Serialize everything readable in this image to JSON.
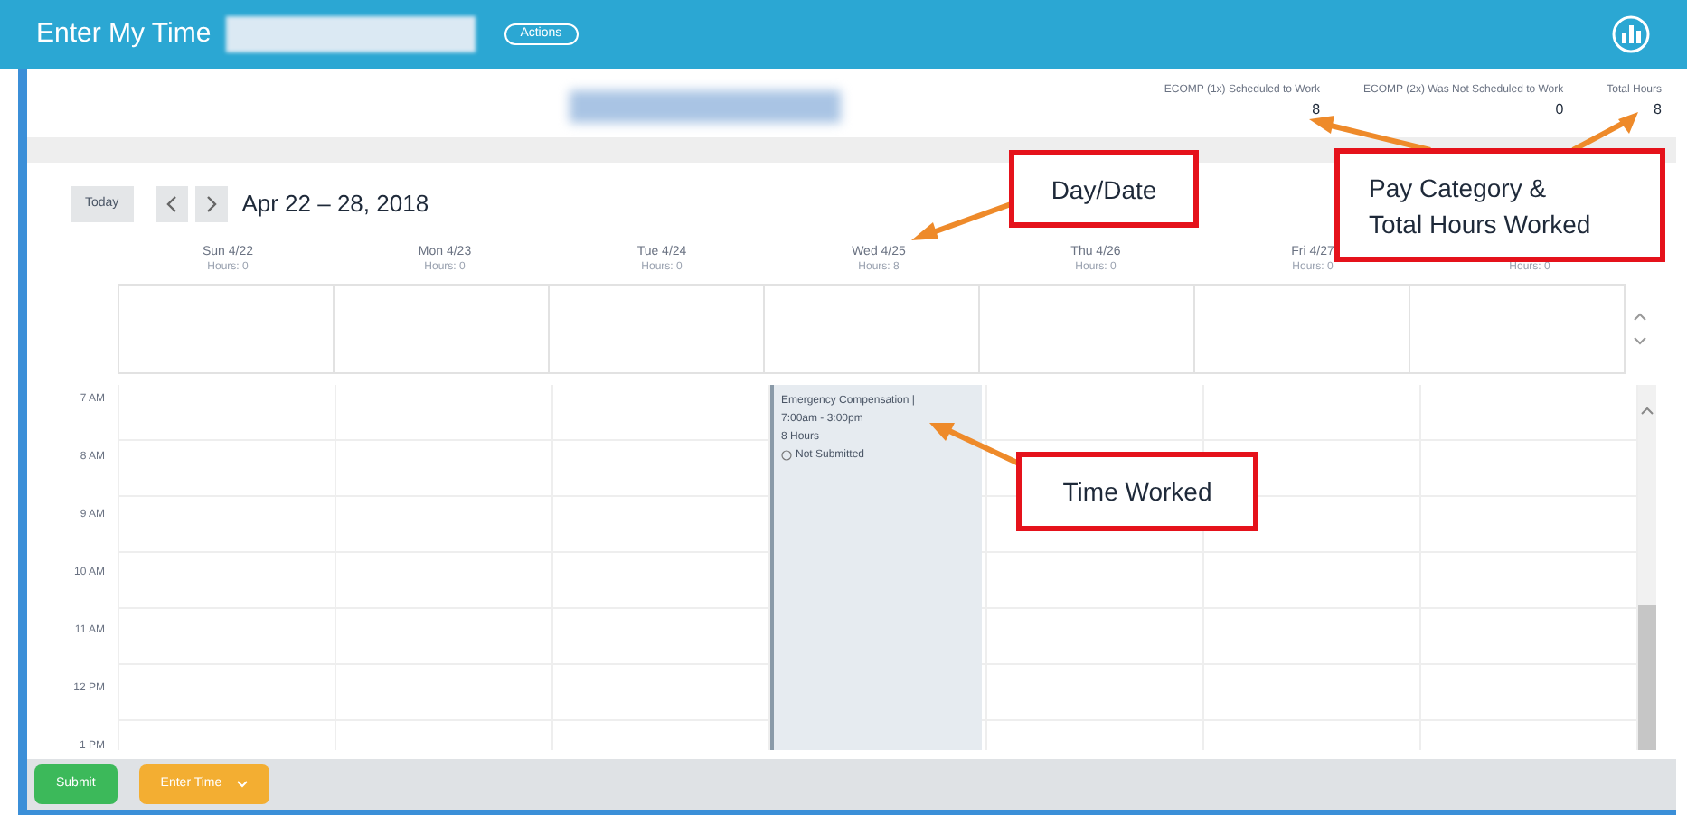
{
  "header": {
    "title": "Enter My Time",
    "actions_button": "Actions"
  },
  "summary": [
    {
      "label": "ECOMP (1x) Scheduled to Work",
      "value": "8"
    },
    {
      "label": "ECOMP (2x) Was Not Scheduled to Work",
      "value": "0"
    },
    {
      "label": "Total Hours",
      "value": "8"
    }
  ],
  "toolbar": {
    "today_button": "Today",
    "date_range": "Apr 22 – 28, 2018"
  },
  "days": [
    {
      "label": "Sun 4/22",
      "hours": "Hours: 0"
    },
    {
      "label": "Mon 4/23",
      "hours": "Hours: 0"
    },
    {
      "label": "Tue 4/24",
      "hours": "Hours: 0"
    },
    {
      "label": "Wed 4/25",
      "hours": "Hours: 8",
      "events": [
        {
          "title": "Emergency Compensation |",
          "time": "7:00am - 3:00pm",
          "duration": "8 Hours",
          "status": "Not Submitted"
        }
      ]
    },
    {
      "label": "Thu 4/26",
      "hours": "Hours: 0"
    },
    {
      "label": "Fri 4/27",
      "hours": "Hours: 0"
    },
    {
      "hours": "Hours: 0"
    }
  ],
  "time_slots": [
    "7 AM",
    "8 AM",
    "9 AM",
    "10 AM",
    "11 AM",
    "12 PM",
    "1 PM"
  ],
  "footer_buttons": [
    {
      "label": "Submit",
      "kind": "primary"
    },
    {
      "label": "Enter Time",
      "kind": "dropdown"
    }
  ],
  "annotations": [
    {
      "text": "Day/Date",
      "kind": "day"
    },
    {
      "text": "Pay Category & Total Hours Worked",
      "kind": "pay"
    },
    {
      "text": "Time Worked",
      "kind": "time"
    }
  ]
}
